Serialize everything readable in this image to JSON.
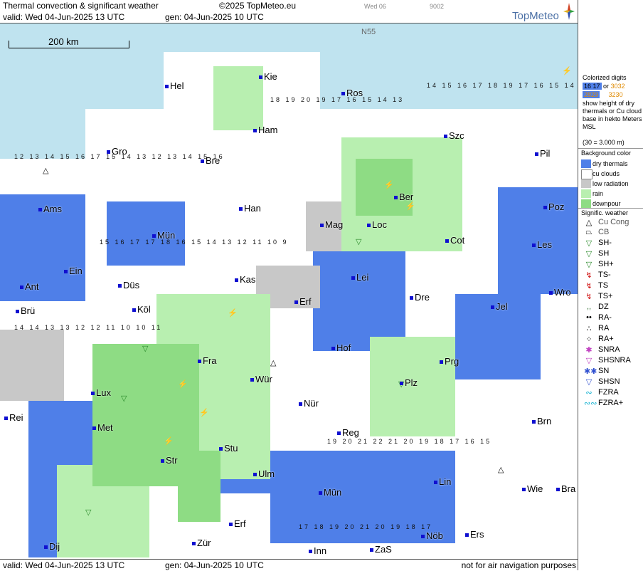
{
  "header": {
    "title": "Thermal convection & significant weather",
    "copyright": "©2025 TopMeteo.eu",
    "valid": "valid:  Wed  04-Jun-2025  13 UTC",
    "generated": "gen: 04-Jun-2025 10 UTC",
    "weekday_small": "Wed 06",
    "code_small": "9002",
    "logo": "TopMeteo"
  },
  "footer": {
    "valid": "valid:  Wed  04-Jun-2025  13 UTC",
    "generated": "gen: 04-Jun-2025 10 UTC",
    "disclaimer": "not for air navigation purposes"
  },
  "map": {
    "scale_label": "200 km",
    "latitude_label": "N55",
    "cities": [
      "Hel",
      "Kie",
      "Ros",
      "Ham",
      "Szc",
      "Gro",
      "Bre",
      "Pil",
      "Ber",
      "Ams",
      "Han",
      "Mag",
      "Loc",
      "Poz",
      "Mün",
      "Cot",
      "Les",
      "Ein",
      "Kas",
      "Lei",
      "Ant",
      "Düs",
      "Wro",
      "Brü",
      "Köl",
      "Erf",
      "Dre",
      "Jel",
      "Hof",
      "Fra",
      "Prg",
      "Lux",
      "Wür",
      "Plz",
      "Nür",
      "Rei",
      "Met",
      "Reg",
      "Brn",
      "Stu",
      "Str",
      "Ulm",
      "Lin",
      "Wie",
      "Bra",
      "Mün",
      "Erf",
      "Nöb",
      "Zür",
      "Dij",
      "Inn",
      "ZaS",
      "Ers"
    ],
    "thermal_digits_sample": [
      "12",
      "13",
      "14",
      "15",
      "16",
      "17",
      "18",
      "19",
      "20",
      "21"
    ]
  },
  "legend": {
    "colorized_title": "Colorized digits",
    "colorized_example_1": "16 17",
    "colorized_or": "or",
    "colorized_example_2": "3032",
    "colorized_example_3": "2829",
    "colorized_example_4": "3230",
    "colorized_desc": "show height of dry thermals or Cu cloud base in hekto Meters MSL",
    "colorized_note": "(30 = 3.000 m)",
    "background_title": "Background color",
    "background_items": [
      "dry thermals",
      "cu clouds",
      "low radiation",
      "rain",
      "downpour"
    ],
    "weather_title": "Signific. weather",
    "weather_items": [
      "Cu Cong",
      "CB",
      "SH-",
      "SH",
      "SH+",
      "TS-",
      "TS",
      "TS+",
      "DZ",
      "RA-",
      "RA",
      "RA+",
      "SNRA",
      "SHSNRA",
      "SN",
      "SHSN",
      "FZRA",
      "FZRA+"
    ]
  },
  "colors": {
    "dry_thermals": "#4f7fe8",
    "cu_clouds": "#ffffff",
    "low_radiation": "#c8c8c8",
    "rain": "#b8efb0",
    "downpour": "#8edc84",
    "sea": "#bfe3ef",
    "logo": "#4a6fa5",
    "orange_digits": "#e08a00"
  }
}
